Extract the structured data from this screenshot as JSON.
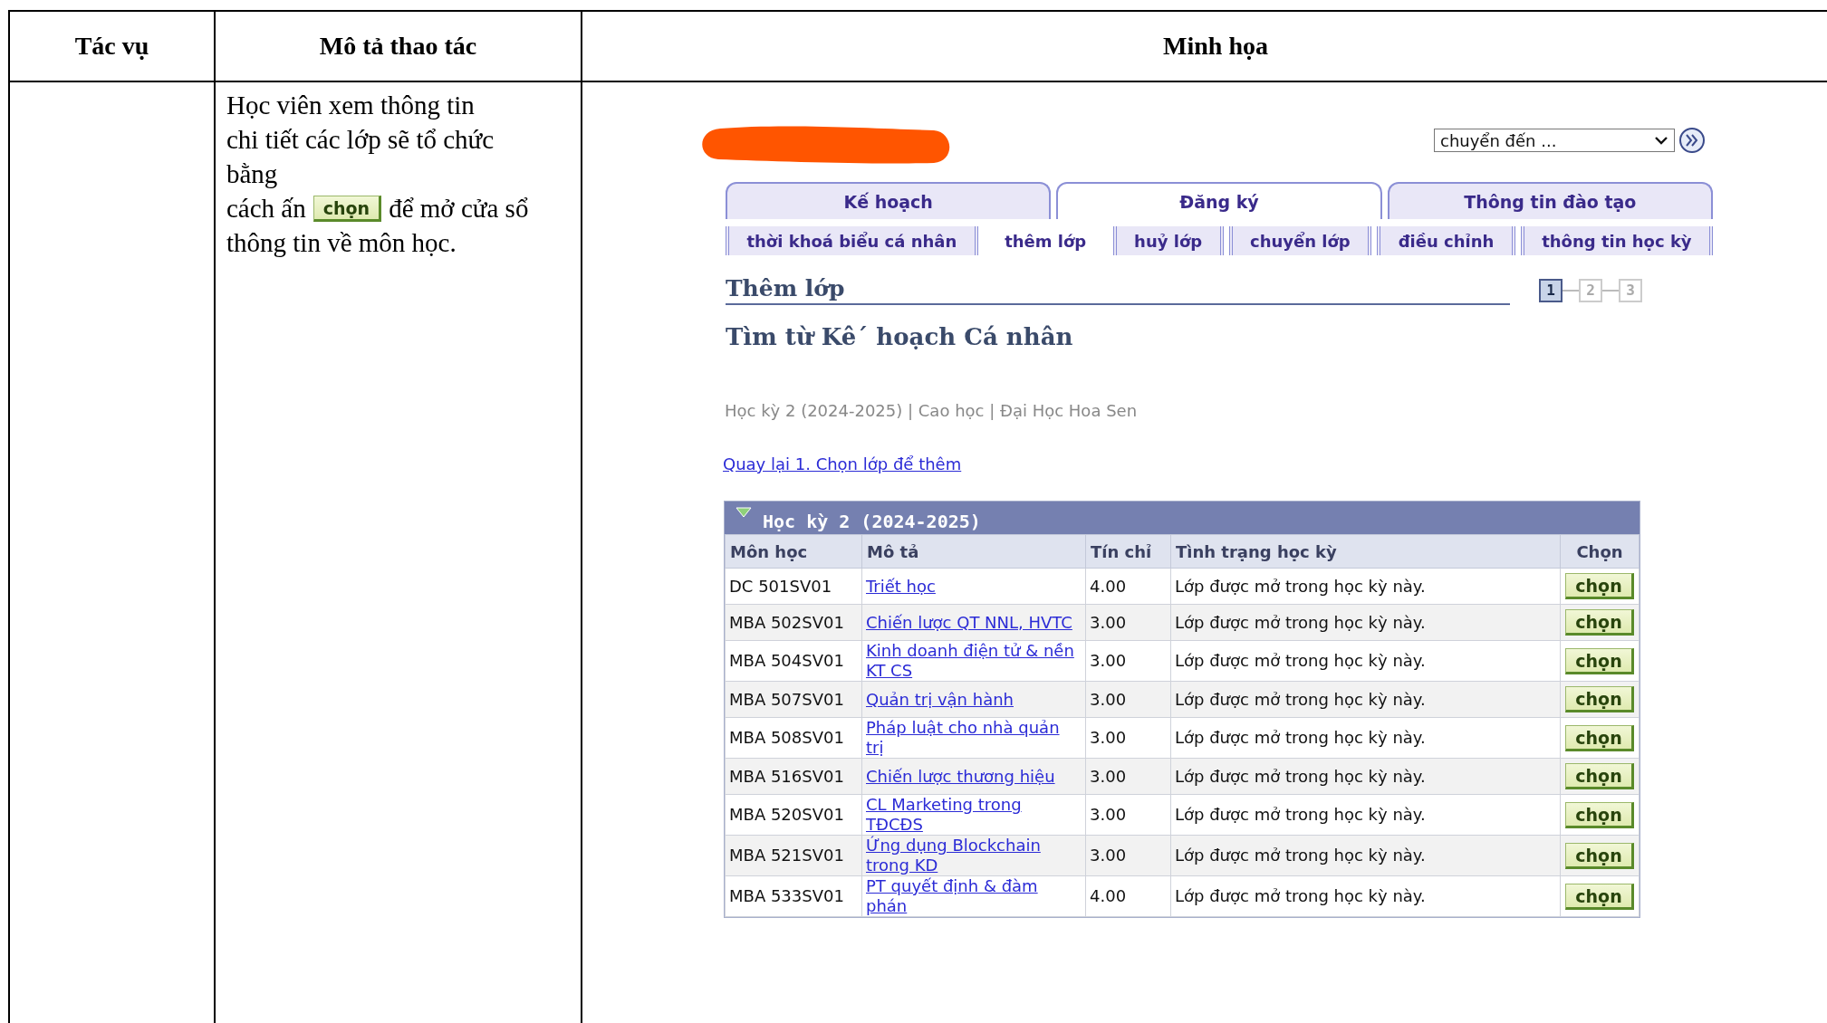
{
  "columns": [
    "Tác vụ",
    "Mô tả thao tác",
    "Minh họa"
  ],
  "description": {
    "intro": "Học viên xem thông tin chi tiết các lớp sẽ tổ chức bằng",
    "before_button": "cách ấn",
    "button": "chọn",
    "after_button": "để mở cửa sổ",
    "ending": "thông tin về môn học."
  },
  "portal": {
    "jump_select": {
      "value": "chuyển đến ..."
    },
    "tabs": [
      {
        "label": "Kế hoạch",
        "selected": false
      },
      {
        "label": "Đăng ký",
        "selected": true
      },
      {
        "label": "Thông tin đào tạo",
        "selected": false
      }
    ],
    "subtabs": [
      {
        "label": "thời khoá biểu cá nhân",
        "selected": false
      },
      {
        "label": "thêm lớp",
        "selected": true
      },
      {
        "label": "huỷ lớp",
        "selected": false
      },
      {
        "label": "chuyển lớp",
        "selected": false
      },
      {
        "label": "điều chỉnh",
        "selected": false
      },
      {
        "label": "thông tin học kỳ",
        "selected": false
      }
    ],
    "section_title": "Thêm lớp",
    "steps": [
      {
        "label": "1",
        "selected": true
      },
      {
        "label": "2",
        "selected": false
      },
      {
        "label": "3",
        "selected": false
      }
    ],
    "page_title": "Tìm từ Kê´ hoạch Cá nhân",
    "term_info": "Học kỳ 2 (2024-2025) | Cao học | Đại Học Hoa Sen",
    "back_link": "Quay lại 1. Chọn lớp để thêm",
    "table": {
      "title": "Học kỳ 2 (2024-2025)",
      "expanded": true,
      "columns": [
        "Môn học",
        "Mô tả",
        "Tín chỉ",
        "Tình trạng học kỳ",
        "Chọn"
      ],
      "rows": [
        {
          "course": "DC 501SV01",
          "description": "Triết học",
          "credits": "4.00",
          "status": "Lớp được mở trong học kỳ này.",
          "action": "chọn"
        },
        {
          "course": "MBA 502SV01",
          "description": "Chiến lược QT NNL, HVTC",
          "credits": "3.00",
          "status": "Lớp được mở trong học kỳ này.",
          "action": "chọn"
        },
        {
          "course": "MBA 504SV01",
          "description": "Kinh doanh điện tử & nền KT CS",
          "credits": "3.00",
          "status": "Lớp được mở trong học kỳ này.",
          "action": "chọn"
        },
        {
          "course": "MBA 507SV01",
          "description": "Quản trị vận hành",
          "credits": "3.00",
          "status": "Lớp được mở trong học kỳ này.",
          "action": "chọn"
        },
        {
          "course": "MBA 508SV01",
          "description": "Pháp luật cho nhà quản trị",
          "credits": "3.00",
          "status": "Lớp được mở trong học kỳ này.",
          "action": "chọn"
        },
        {
          "course": "MBA 516SV01",
          "description": "Chiến lược thương hiệu",
          "credits": "3.00",
          "status": "Lớp được mở trong học kỳ này.",
          "action": "chọn"
        },
        {
          "course": "MBA 520SV01",
          "description": "CL Marketing trong TĐCĐS",
          "credits": "3.00",
          "status": "Lớp được mở trong học kỳ này.",
          "action": "chọn"
        },
        {
          "course": "MBA 521SV01",
          "description": "Ứng dụng Blockchain trong KD",
          "credits": "3.00",
          "status": "Lớp được mở trong học kỳ này.",
          "action": "chọn"
        },
        {
          "course": "MBA 533SV01",
          "description": "PT quyết định & đàm phán",
          "credits": "4.00",
          "status": "Lớp được mở trong học kỳ này.",
          "action": "chọn"
        }
      ]
    }
  }
}
